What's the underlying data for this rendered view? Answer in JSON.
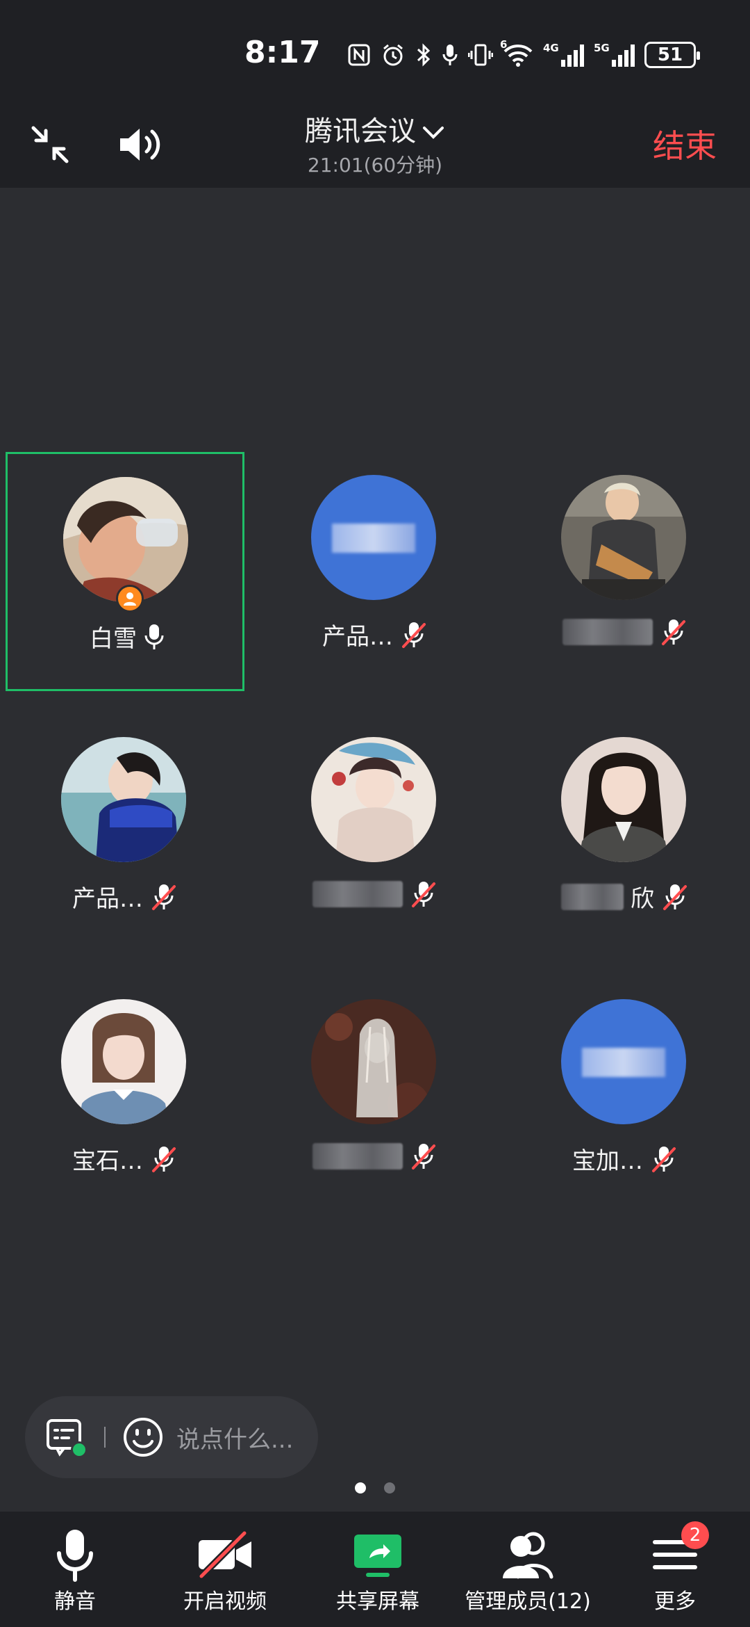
{
  "status_bar": {
    "time": "8:17",
    "net1": "4G",
    "net2": "5G",
    "wifi_sup": "6",
    "battery": "51"
  },
  "header": {
    "title": "腾讯会议",
    "time": "21:01(60分钟)",
    "end_label": "结束"
  },
  "participants": [
    {
      "name": "白雪",
      "mic": "on",
      "host": true,
      "active": true
    },
    {
      "name": "产品…",
      "mic": "muted"
    },
    {
      "name": "",
      "mic": "muted",
      "name_blurred": true
    },
    {
      "name": "产品…",
      "mic": "muted"
    },
    {
      "name": "",
      "mic": "muted",
      "name_blurred": true
    },
    {
      "name": "欣",
      "mic": "muted",
      "name_blurred": true
    },
    {
      "name": "宝石…",
      "mic": "muted"
    },
    {
      "name": "",
      "mic": "muted",
      "name_blurred": true
    },
    {
      "name": "宝加…",
      "mic": "muted"
    }
  ],
  "chat": {
    "placeholder": "说点什么..."
  },
  "pager": {
    "pages": 2,
    "current": 1
  },
  "toolbar": {
    "mute": "静音",
    "video": "开启视频",
    "share": "共享屏幕",
    "members": "管理成员(12)",
    "more": "更多",
    "more_badge": "2"
  },
  "colors": {
    "background": "#2c2d31",
    "bar": "#1f2024",
    "accent_green": "#1fbe67",
    "end_red": "#ff4d4f",
    "avatar_blue": "#3f73d6"
  }
}
